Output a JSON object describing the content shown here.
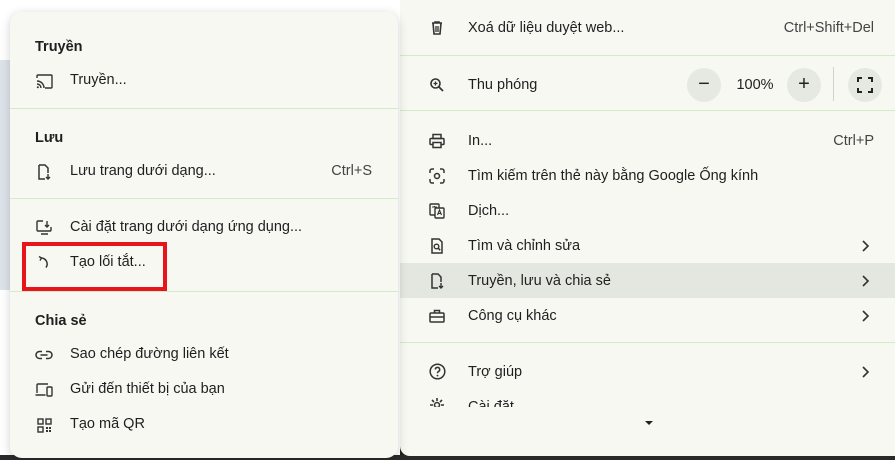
{
  "main_menu": {
    "clear_data": {
      "label": "Xoá dữ liệu duyệt web...",
      "shortcut": "Ctrl+Shift+Del"
    },
    "zoom": {
      "label": "Thu phóng",
      "minus": "−",
      "value": "100%",
      "plus": "+"
    },
    "print": {
      "label": "In...",
      "shortcut": "Ctrl+P"
    },
    "lens": {
      "label": "Tìm kiếm trên thẻ này bằng Google Ống kính"
    },
    "translate": {
      "label": "Dịch..."
    },
    "find_edit": {
      "label": "Tìm và chỉnh sửa"
    },
    "cast_save_share": {
      "label": "Truyền, lưu và chia sẻ"
    },
    "more_tools": {
      "label": "Công cụ khác"
    },
    "help": {
      "label": "Trợ giúp"
    },
    "settings": {
      "label": "Cài đặt"
    }
  },
  "submenu": {
    "cast_heading": "Truyền",
    "cast_item": "Truyền...",
    "save_heading": "Lưu",
    "save_page": {
      "label": "Lưu trang dưới dạng...",
      "shortcut": "Ctrl+S"
    },
    "install_app": "Cài đặt trang dưới dạng ứng dụng...",
    "create_shortcut": "Tạo lối tắt...",
    "share_heading": "Chia sẻ",
    "copy_link": "Sao chép đường liên kết",
    "send_device": "Gửi đến thiết bị của bạn",
    "qr_code": "Tạo mã QR"
  },
  "colors": {
    "menu_bg": "#f6f8f1",
    "highlight_bg": "#e4e7df",
    "divider": "#d5ebc4",
    "annotation_red": "#e8141c"
  }
}
